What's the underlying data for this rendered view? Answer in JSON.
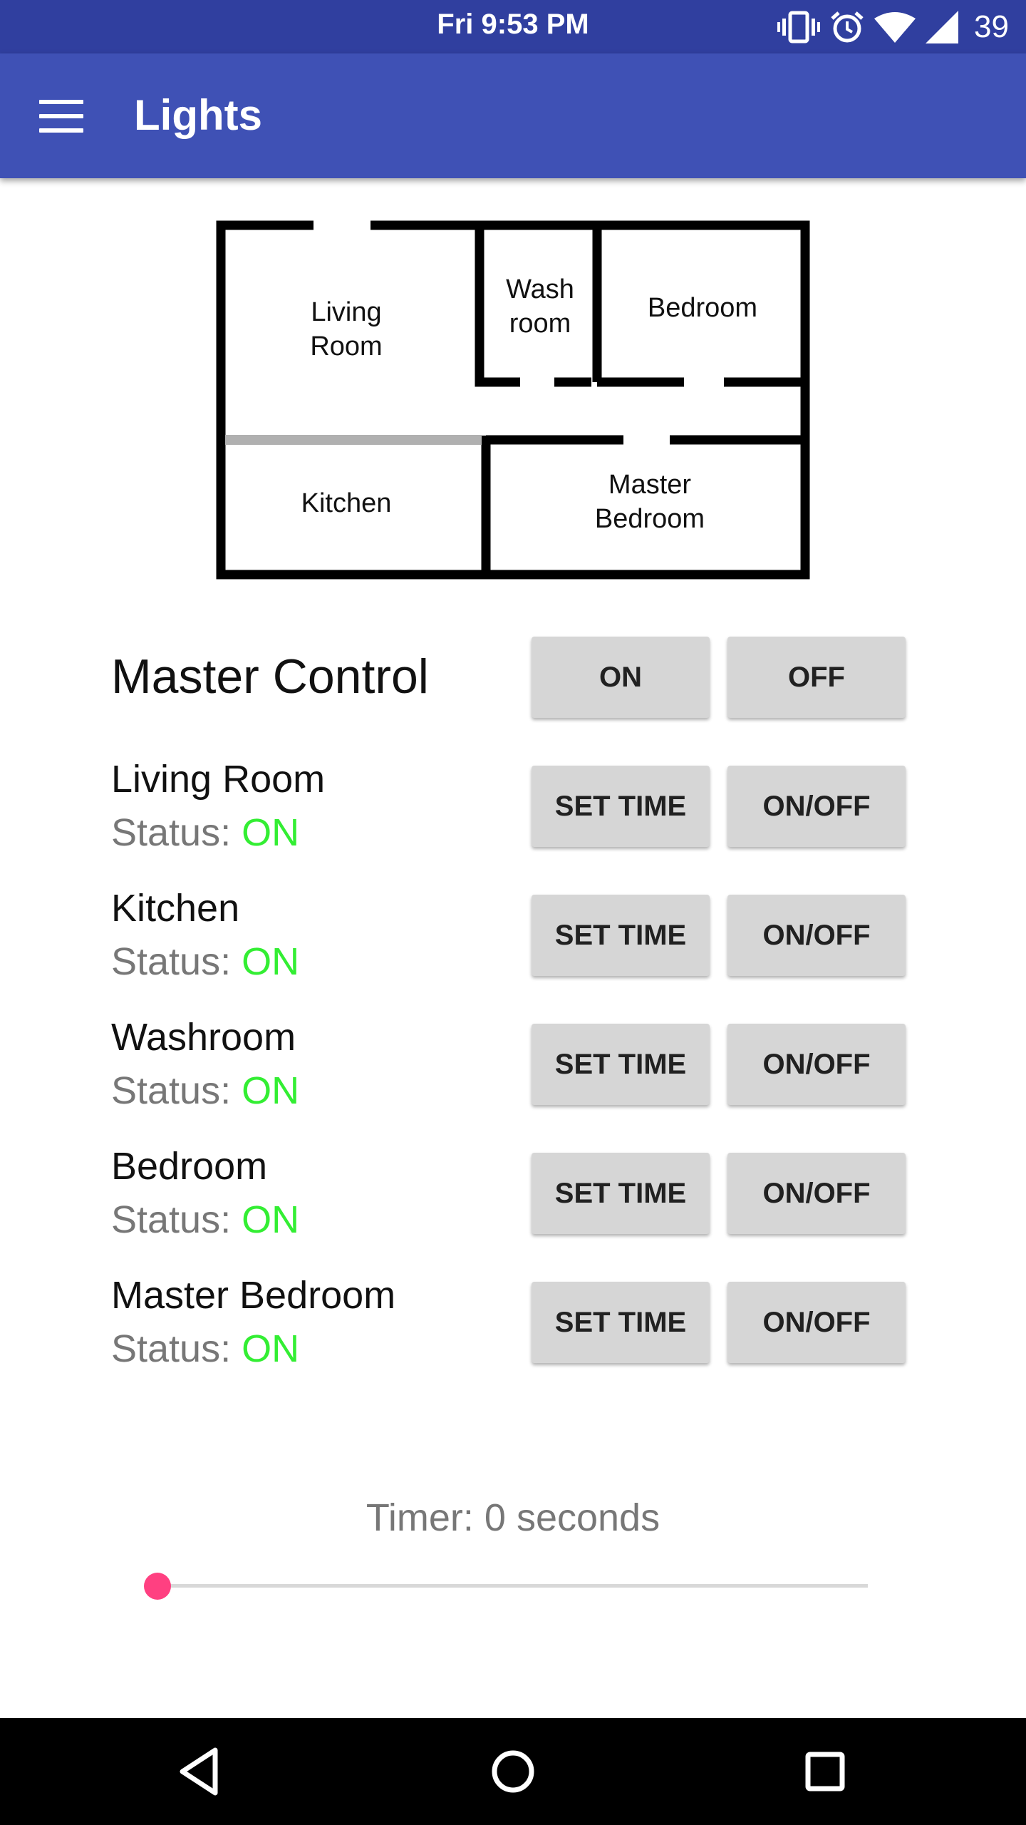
{
  "status_bar": {
    "time": "Fri 9:53 PM",
    "battery": "39",
    "icons": [
      "vibrate-icon",
      "alarm-icon",
      "wifi-icon",
      "signal-icon"
    ]
  },
  "app_bar": {
    "title": "Lights",
    "menu_icon": "hamburger-menu-icon"
  },
  "floor_plan": {
    "rooms": [
      {
        "line1": "Living",
        "line2": "Room"
      },
      {
        "line1": "Wash",
        "line2": "room"
      },
      {
        "line1": "Bedroom"
      },
      {
        "line1": "Kitchen"
      },
      {
        "line1": "Master",
        "line2": "Bedroom"
      }
    ]
  },
  "master_control": {
    "label": "Master Control",
    "on_label": "ON",
    "off_label": "OFF"
  },
  "rooms": [
    {
      "name": "Living Room",
      "status_label": "Status: ",
      "status_value": "ON",
      "set_time_label": "SET TIME",
      "toggle_label": "ON/OFF"
    },
    {
      "name": "Kitchen",
      "status_label": "Status: ",
      "status_value": "ON",
      "set_time_label": "SET TIME",
      "toggle_label": "ON/OFF"
    },
    {
      "name": "Washroom",
      "status_label": "Status: ",
      "status_value": "ON",
      "set_time_label": "SET TIME",
      "toggle_label": "ON/OFF"
    },
    {
      "name": "Bedroom",
      "status_label": "Status: ",
      "status_value": "ON",
      "set_time_label": "SET TIME",
      "toggle_label": "ON/OFF"
    },
    {
      "name": "Master Bedroom",
      "status_label": "Status: ",
      "status_value": "ON",
      "set_time_label": "SET TIME",
      "toggle_label": "ON/OFF"
    }
  ],
  "timer": {
    "label": "Timer: 0 seconds",
    "slider_fraction": 0
  },
  "colors": {
    "status_bar": "#303f9f",
    "app_bar": "#3f51b5",
    "status_on": "#33ee33",
    "slider_accent": "#ff4081"
  },
  "nav_bar": {
    "icons": [
      "back-icon",
      "home-icon",
      "recents-icon"
    ]
  }
}
